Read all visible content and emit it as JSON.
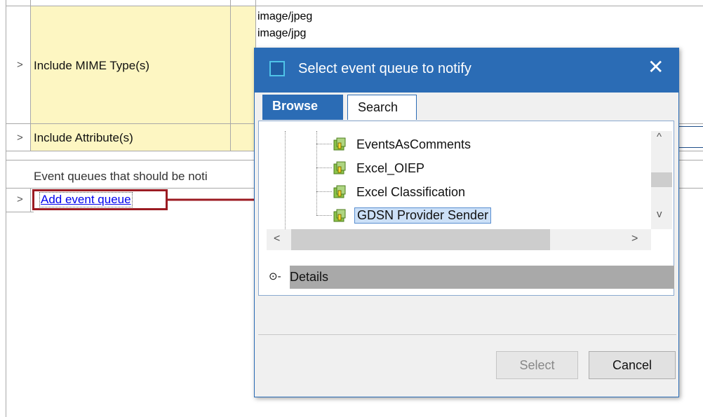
{
  "background": {
    "rows": [
      {
        "chevron": ">",
        "label": "Include MIME Type(s)"
      },
      {
        "chevron": ">",
        "label": "Include Attribute(s)"
      }
    ],
    "mime_values": [
      "image/jpeg",
      "image/jpg"
    ],
    "event_queues_label": "Event queues that should be noti",
    "add_row_chevron": ">",
    "add_event_queue_link": "Add event queue"
  },
  "dialog": {
    "title": "Select event queue to notify",
    "close_glyph": "✕",
    "tabs": [
      {
        "label": "Browse",
        "active": true
      },
      {
        "label": "Search",
        "active": false
      }
    ],
    "tree_items": [
      {
        "label": "EventsAsComments",
        "selected": false
      },
      {
        "label": "Excel_OIEP",
        "selected": false
      },
      {
        "label": "Excel Classification",
        "selected": false
      },
      {
        "label": "GDSN Provider Sender",
        "selected": true
      }
    ],
    "scroll_glyphs": {
      "up": "^",
      "down": "v",
      "left": "<",
      "right": ">"
    },
    "details_icon": "⊙-",
    "details_label": "Details",
    "buttons": {
      "select": "Select",
      "cancel": "Cancel"
    }
  },
  "colors": {
    "accent": "#2b6cb5",
    "highlight_border": "#9b1b22",
    "row_yellow": "#fdf6c2",
    "node_icon_green": "#7cb342"
  }
}
